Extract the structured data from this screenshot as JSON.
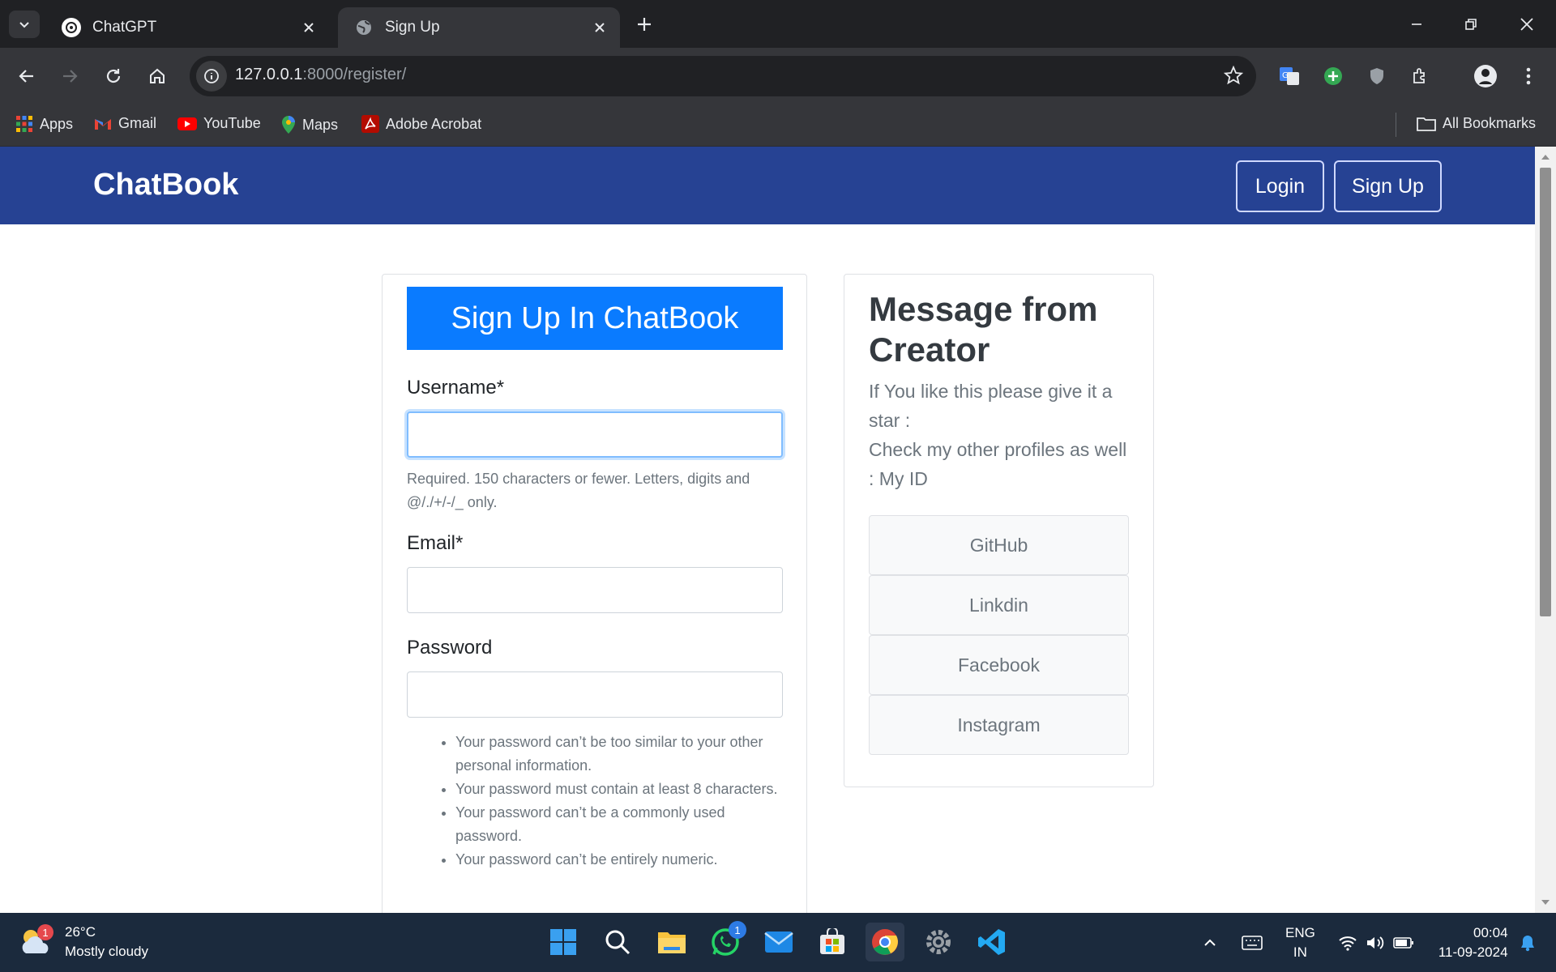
{
  "browser": {
    "tabs": [
      {
        "title": "ChatGPT",
        "icon": "chatgpt-icon",
        "active": false
      },
      {
        "title": "Sign Up",
        "icon": "globe-icon",
        "active": true
      }
    ],
    "url_host": "127.0.0.1",
    "url_rest": ":8000/register/",
    "bookmarks": [
      {
        "label": "Apps",
        "icon": "apps-grid-icon"
      },
      {
        "label": "Gmail",
        "icon": "gmail-icon"
      },
      {
        "label": "YouTube",
        "icon": "youtube-icon"
      },
      {
        "label": "Maps",
        "icon": "maps-icon"
      },
      {
        "label": "Adobe Acrobat",
        "icon": "acrobat-icon"
      }
    ],
    "all_bookmarks": "All Bookmarks"
  },
  "navbar": {
    "brand": "ChatBook",
    "login": "Login",
    "signup": "Sign Up"
  },
  "form": {
    "header": "Sign Up In ChatBook",
    "username_label": "Username*",
    "username_value": "",
    "username_help": "Required. 150 characters or fewer. Letters, digits and @/./+/-/_ only.",
    "email_label": "Email*",
    "email_value": "",
    "password_label": "Password",
    "password_value": "",
    "password_rules": [
      "Your password can’t be too similar to your other personal information.",
      "Your password must contain at least 8 characters.",
      "Your password can’t be a commonly used password.",
      "Your password can’t be entirely numeric."
    ]
  },
  "message": {
    "title": "Message from Creator",
    "line1": "If You like this please give it a star :",
    "line2": "Check my other profiles as well : My ID",
    "links": [
      "GitHub",
      "Linkdin",
      "Facebook",
      "Instagram"
    ]
  },
  "taskbar": {
    "temperature": "26°C",
    "weather": "Mostly cloudy",
    "weather_badge": "1",
    "whatsapp_badge": "1",
    "lang_top": "ENG",
    "lang_bottom": "IN",
    "time": "00:04",
    "date": "11-09-2024"
  }
}
